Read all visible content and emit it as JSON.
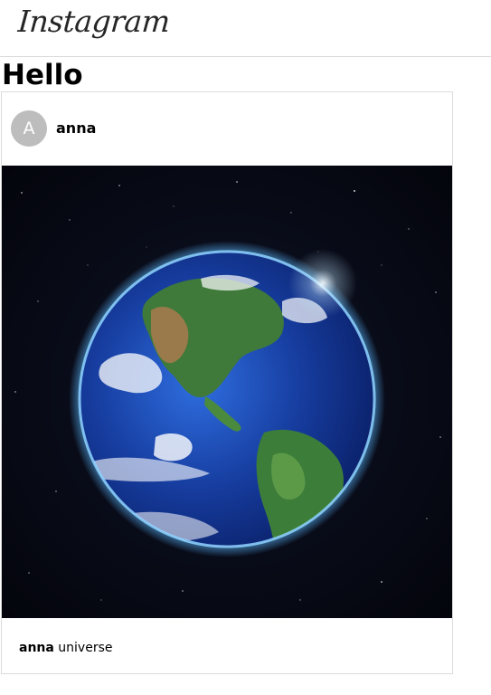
{
  "header": {
    "logo_text": "Instagram"
  },
  "page": {
    "title": "Hello"
  },
  "post": {
    "avatar_letter": "A",
    "username": "anna",
    "image_icon": "earth-from-space-image",
    "caption_username": "anna",
    "caption_text": "universe"
  },
  "colors": {
    "border": "#dbdbdb",
    "avatar_bg": "#bdbdbd",
    "space_bg": "#06070f",
    "ocean": "#1a3ea8",
    "glow": "#5ab8ff"
  }
}
